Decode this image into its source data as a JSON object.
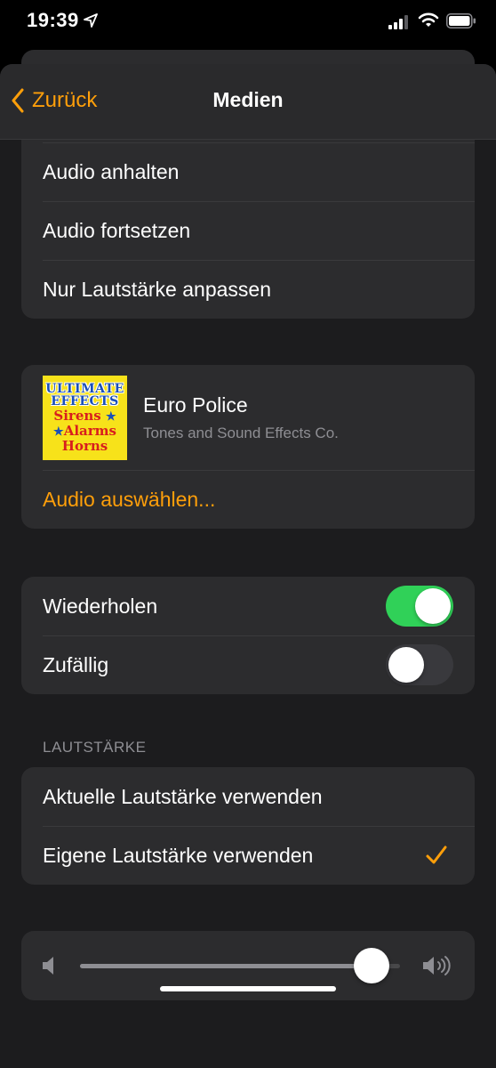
{
  "status_bar": {
    "time": "19:39",
    "icons": [
      "location-arrow-icon",
      "cellular-signal-icon",
      "wifi-icon",
      "battery-icon"
    ]
  },
  "nav": {
    "back_label": "Zurück",
    "title": "Medien"
  },
  "audio_actions": [
    {
      "label": "Audio anhalten"
    },
    {
      "label": "Audio fortsetzen"
    },
    {
      "label": "Nur Lautstärke anpassen"
    }
  ],
  "track": {
    "title": "Euro Police",
    "artist": "Tones and Sound Effects Co.",
    "artwork": {
      "line1": "ULTIMATE",
      "line2": "EFFECTS",
      "line3": "Sirens",
      "line4": "Alarms",
      "line5": "Horns"
    },
    "choose_label": "Audio auswählen..."
  },
  "toggles": [
    {
      "label": "Wiederholen",
      "on": true
    },
    {
      "label": "Zufällig",
      "on": false
    }
  ],
  "volume": {
    "section_header": "LAUTSTÄRKE",
    "options": [
      {
        "label": "Aktuelle Lautstärke verwenden",
        "selected": false
      },
      {
        "label": "Eigene Lautstärke verwenden",
        "selected": true
      }
    ],
    "slider_level": 0.91
  },
  "colors": {
    "accent": "#ff9f0a",
    "toggle_on": "#30d158",
    "group_bg": "#2c2c2e"
  }
}
